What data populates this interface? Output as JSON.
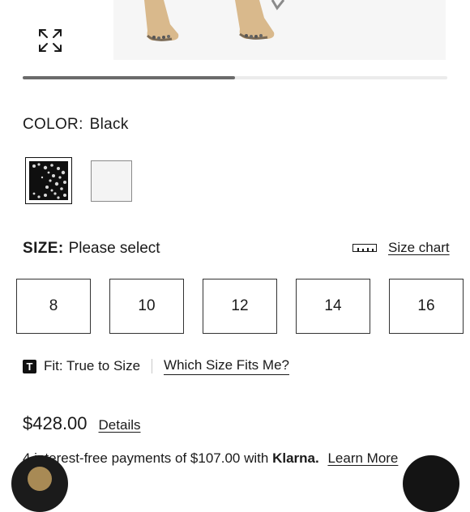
{
  "gallery": {
    "expand_icon": "expand-arrows-icon",
    "progress_fraction": 0.5
  },
  "color": {
    "label": "COLOR:",
    "selected": "Black",
    "swatches": [
      {
        "name": "black",
        "selected": true
      },
      {
        "name": "white",
        "selected": false
      }
    ]
  },
  "size": {
    "label": "SIZE:",
    "value": "Please select",
    "chart_label": "Size chart",
    "chart_icon": "ruler-icon",
    "options": [
      "8",
      "10",
      "12",
      "14",
      "16"
    ]
  },
  "fit": {
    "badge": "T",
    "text": "Fit: True to Size",
    "link": "Which Size Fits Me?"
  },
  "price": {
    "amount": "$428.00",
    "details_label": "Details"
  },
  "klarna": {
    "text": "4 interest-free payments of $107.00 with",
    "brand": "Klarna.",
    "link": "Learn More"
  }
}
